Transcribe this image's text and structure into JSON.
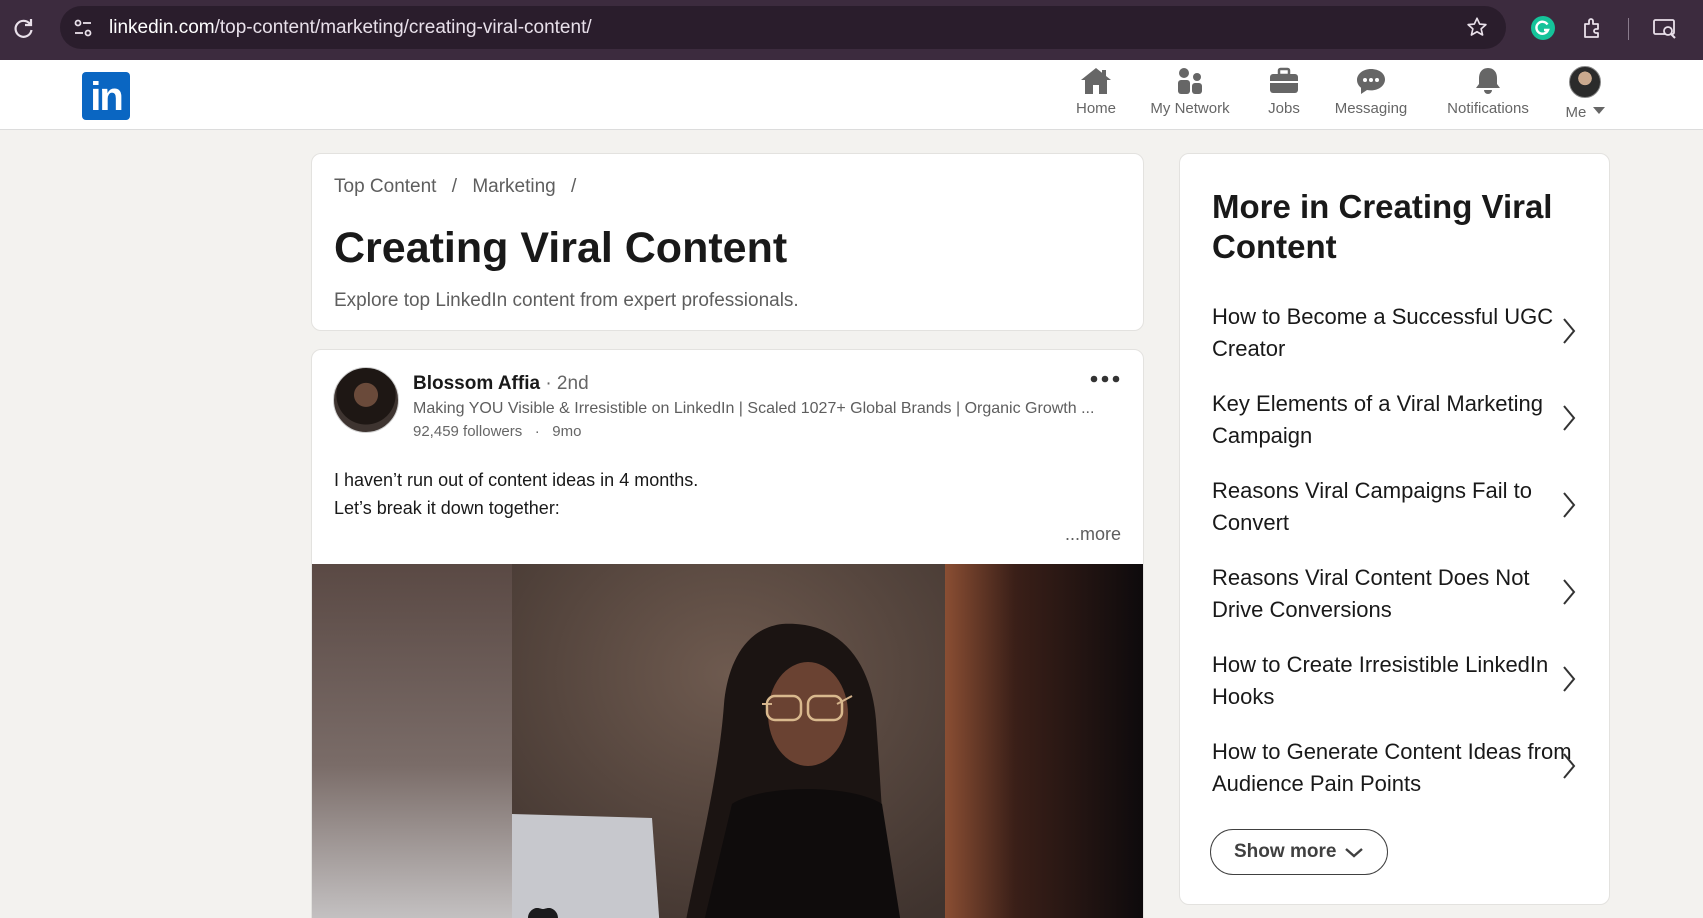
{
  "browser": {
    "url_host": "linkedin.com",
    "url_path": "/top-content/marketing/creating-viral-content/"
  },
  "nav": {
    "logo": "in",
    "items": [
      {
        "label": "Home",
        "icon": "home-icon"
      },
      {
        "label": "My Network",
        "icon": "network-icon"
      },
      {
        "label": "Jobs",
        "icon": "briefcase-icon"
      },
      {
        "label": "Messaging",
        "icon": "chat-icon"
      },
      {
        "label": "Notifications",
        "icon": "bell-icon"
      },
      {
        "label": "Me",
        "icon": "avatar"
      }
    ]
  },
  "header": {
    "breadcrumb": [
      "Top Content",
      "/",
      "Marketing",
      "/"
    ],
    "title": "Creating Viral Content",
    "subtitle": "Explore top LinkedIn content from expert professionals."
  },
  "post": {
    "author": "Blossom Affia",
    "degree": "· 2nd",
    "headline": "Making YOU Visible & Irresistible on LinkedIn | Scaled 1027+ Global Brands | Organic Growth ...",
    "followers": "92,459 followers",
    "meta_sep": "·",
    "age": "9mo",
    "text_line1": "I haven’t run out of content ideas in 4 months.",
    "text_line2": "Let’s break it down together:",
    "more": "...more"
  },
  "sidebar": {
    "title": "More in Creating Viral Content",
    "items": [
      "How to Become a Successful UGC Creator",
      "Key Elements of a Viral Marketing Campaign",
      "Reasons Viral Campaigns Fail to Convert",
      "Reasons Viral Content Does Not Drive Conversions",
      "How to Create Irresistible LinkedIn Hooks",
      "How to Generate Content Ideas from Audience Pain Points"
    ],
    "show_more": "Show more"
  },
  "colors": {
    "brand": "#0a66c2",
    "chrome_bg": "#3c2b3e",
    "page_bg": "#f3f2ef"
  }
}
